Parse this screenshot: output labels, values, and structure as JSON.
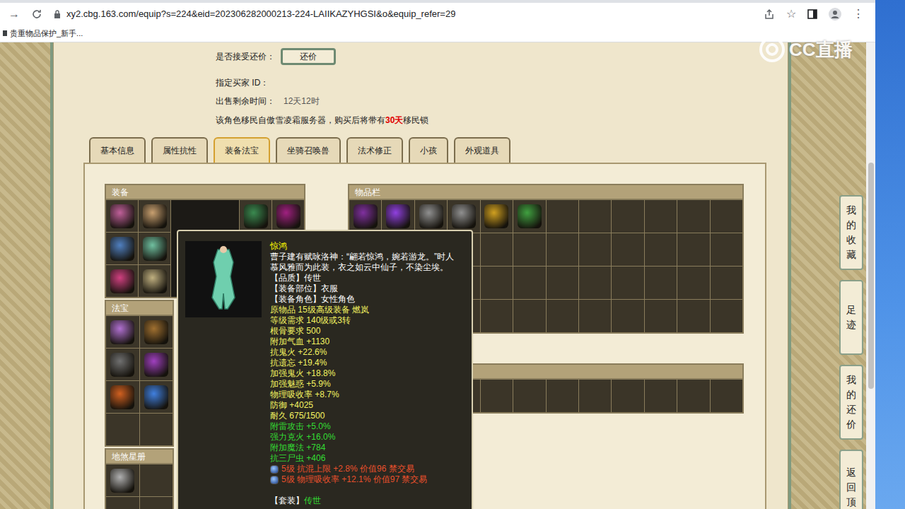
{
  "browser": {
    "url": "xy2.cbg.163.com/equip?s=224&eid=202306282000213-224-LAIIKAZYHGSI&o&equip_refer=29",
    "bookmark": "贵重物品保护_新手..."
  },
  "watermark": "CC直播",
  "info": {
    "bargain_label": "是否接受还价：",
    "bargain_button": "还价",
    "buyer_label": "指定买家 ID：",
    "time_label": "出售剩余时间：",
    "time_value": "12天12时",
    "migrate_before": "该角色移民自傲雪凌霜服务器，购买后将带有",
    "migrate_highlight": "30天",
    "migrate_after": "移民锁"
  },
  "tabs": [
    {
      "label": "基本信息",
      "selected": false
    },
    {
      "label": "属性抗性",
      "selected": false
    },
    {
      "label": "装备法宝",
      "selected": true
    },
    {
      "label": "坐骑召唤兽",
      "selected": false
    },
    {
      "label": "法术修正",
      "selected": false
    },
    {
      "label": "小孩",
      "selected": false
    },
    {
      "label": "外观道具",
      "selected": false
    }
  ],
  "equipment": {
    "title": "装备",
    "slots": [
      {
        "filled": true,
        "color": "#c0609a"
      },
      {
        "filled": true,
        "color": "#c8a070"
      },
      {
        "filled": true,
        "color": "#3a8a50"
      },
      {
        "filled": true,
        "color": "#a02080"
      },
      {
        "filled": true,
        "color": "#5080c0"
      },
      {
        "filled": true,
        "color": "#70c0a0"
      },
      {
        "filled": false,
        "color": "#000000"
      },
      {
        "filled": false,
        "color": "#000000"
      },
      {
        "filled": true,
        "color": "#d04080"
      },
      {
        "filled": true,
        "color": "#c0b080"
      },
      {
        "filled": false,
        "color": "#000000"
      },
      {
        "filled": false,
        "color": "#000000"
      }
    ]
  },
  "fabao": {
    "title": "法宝",
    "slots": [
      {
        "filled": true,
        "color": "#b070d0"
      },
      {
        "filled": true,
        "color": "#a07030"
      },
      {
        "filled": true,
        "color": "#707070"
      },
      {
        "filled": true,
        "color": "#a040c0"
      },
      {
        "filled": true,
        "color": "#d06020"
      },
      {
        "filled": true,
        "color": "#4080e0"
      },
      {
        "filled": false,
        "color": "#000000"
      },
      {
        "filled": false,
        "color": "#000000"
      }
    ]
  },
  "dishaxingce": {
    "title": "地煞星册",
    "slots": [
      {
        "filled": true,
        "color": "#b0b0b0"
      },
      {
        "filled": false,
        "color": "#000000"
      },
      {
        "filled": false,
        "color": "#000000"
      },
      {
        "filled": false,
        "color": "#000000"
      }
    ]
  },
  "inventory": {
    "title": "物品栏",
    "slots": [
      {
        "filled": true,
        "color": "#8030a0"
      },
      {
        "filled": true,
        "color": "#9040e0"
      },
      {
        "filled": true,
        "color": "#909090"
      },
      {
        "filled": true,
        "color": "#909090"
      },
      {
        "filled": true,
        "color": "#d0a020"
      },
      {
        "filled": true,
        "color": "#40a040"
      },
      {
        "filled": false,
        "color": "#000000"
      },
      {
        "filled": false,
        "color": "#000000"
      },
      {
        "filled": false,
        "color": "#000000"
      },
      {
        "filled": false,
        "color": "#000000"
      },
      {
        "filled": false,
        "color": "#000000"
      },
      {
        "filled": false,
        "color": "#000000"
      },
      {
        "filled": false,
        "color": "#000000"
      },
      {
        "filled": false,
        "color": "#000000"
      },
      {
        "filled": false,
        "color": "#000000"
      },
      {
        "filled": false,
        "color": "#000000"
      },
      {
        "filled": false,
        "color": "#000000"
      },
      {
        "filled": false,
        "color": "#000000"
      },
      {
        "filled": false,
        "color": "#000000"
      },
      {
        "filled": false,
        "color": "#000000"
      },
      {
        "filled": false,
        "color": "#000000"
      },
      {
        "filled": false,
        "color": "#000000"
      },
      {
        "filled": false,
        "color": "#000000"
      },
      {
        "filled": false,
        "color": "#000000"
      },
      {
        "filled": false,
        "color": "#000000"
      },
      {
        "filled": false,
        "color": "#000000"
      },
      {
        "filled": false,
        "color": "#000000"
      },
      {
        "filled": false,
        "color": "#000000"
      },
      {
        "filled": false,
        "color": "#000000"
      },
      {
        "filled": false,
        "color": "#000000"
      },
      {
        "filled": false,
        "color": "#000000"
      },
      {
        "filled": false,
        "color": "#000000"
      },
      {
        "filled": false,
        "color": "#000000"
      },
      {
        "filled": false,
        "color": "#000000"
      },
      {
        "filled": false,
        "color": "#000000"
      },
      {
        "filled": false,
        "color": "#000000"
      },
      {
        "filled": false,
        "color": "#000000"
      },
      {
        "filled": false,
        "color": "#000000"
      },
      {
        "filled": false,
        "color": "#000000"
      },
      {
        "filled": false,
        "color": "#000000"
      },
      {
        "filled": false,
        "color": "#000000"
      },
      {
        "filled": false,
        "color": "#000000"
      },
      {
        "filled": false,
        "color": "#000000"
      },
      {
        "filled": false,
        "color": "#000000"
      },
      {
        "filled": false,
        "color": "#000000"
      },
      {
        "filled": false,
        "color": "#000000"
      },
      {
        "filled": false,
        "color": "#000000"
      },
      {
        "filled": false,
        "color": "#000000"
      }
    ]
  },
  "storage": {
    "slots": [
      {
        "filled": false,
        "color": "#000000"
      },
      {
        "filled": false,
        "color": "#000000"
      },
      {
        "filled": false,
        "color": "#000000"
      },
      {
        "filled": false,
        "color": "#000000"
      },
      {
        "filled": false,
        "color": "#000000"
      },
      {
        "filled": false,
        "color": "#000000"
      },
      {
        "filled": false,
        "color": "#000000"
      },
      {
        "filled": false,
        "color": "#000000"
      },
      {
        "filled": false,
        "color": "#000000"
      },
      {
        "filled": false,
        "color": "#000000"
      },
      {
        "filled": false,
        "color": "#000000"
      },
      {
        "filled": false,
        "color": "#000000"
      }
    ]
  },
  "tooltip": {
    "lines": [
      {
        "text": "惊鸿",
        "kind": "title"
      },
      {
        "text": "曹子建有赋咏洛神：“翩若惊鸿，婉若游龙。”时人",
        "kind": "desc"
      },
      {
        "text": "慕风雅而为此装，衣之如云中仙子，不染尘埃。",
        "kind": "desc"
      },
      {
        "text": "【品质】传世",
        "kind": "desc"
      },
      {
        "text": "【装备部位】衣服",
        "kind": "desc"
      },
      {
        "text": "【装备角色】女性角色",
        "kind": "desc"
      },
      {
        "text": "原物品 15级高级装备 燃岚",
        "kind": "yellow"
      },
      {
        "text": "等级需求 140级或3转",
        "kind": "yellow"
      },
      {
        "text": "根骨要求 500",
        "kind": "yellow"
      },
      {
        "text": "附加气血 +1130",
        "kind": "yellow"
      },
      {
        "text": "抗鬼火 +22.6%",
        "kind": "yellow"
      },
      {
        "text": "抗遗忘 +19.4%",
        "kind": "yellow"
      },
      {
        "text": "加强鬼火 +18.8%",
        "kind": "yellow"
      },
      {
        "text": "加强魅惑 +5.9%",
        "kind": "yellow"
      },
      {
        "text": "物理吸收率 +8.7%",
        "kind": "yellow"
      },
      {
        "text": "防御 +4025",
        "kind": "yellow"
      },
      {
        "text": "耐久 675/1500",
        "kind": "yellow"
      },
      {
        "text": "附雷攻击 +5.0%",
        "kind": "green"
      },
      {
        "text": "强力克火 +16.0%",
        "kind": "green"
      },
      {
        "text": "附加魔法 +784",
        "kind": "green"
      },
      {
        "text": "抗三尸虫 +406",
        "kind": "green"
      },
      {
        "text": "5级 抗混上限 +2.8% 价值96 禁交易",
        "kind": "gem"
      },
      {
        "text": "5级 物理吸收率 +12.1% 价值97 禁交易",
        "kind": "gem"
      }
    ],
    "set_label": "【套装】",
    "set_value": "传世"
  },
  "side_buttons": [
    "我的收藏",
    "足迹",
    "我的还价",
    "返回顶"
  ]
}
